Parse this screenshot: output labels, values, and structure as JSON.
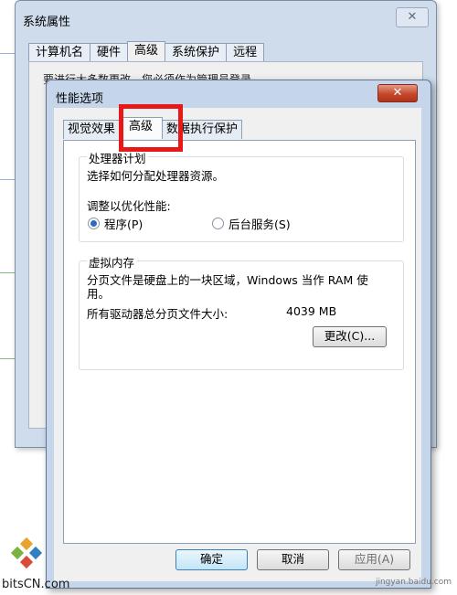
{
  "background_window": {
    "title": "系统属性",
    "close_glyph": "✕",
    "tabs": [
      {
        "label": "计算机名",
        "selected": false
      },
      {
        "label": "硬件",
        "selected": false
      },
      {
        "label": "高级",
        "selected": true
      },
      {
        "label": "系统保护",
        "selected": false
      },
      {
        "label": "远程",
        "selected": false
      }
    ],
    "partial_text": "要进行大多数更改，您必须作为管理员登录。"
  },
  "dialog": {
    "title": "性能选项",
    "close_glyph": "✕",
    "tabs": [
      {
        "label": "视觉效果",
        "selected": false
      },
      {
        "label": "高级",
        "selected": true
      },
      {
        "label": "数据执行保护",
        "selected": false
      }
    ],
    "processor_group": {
      "title": "处理器计划",
      "description": "选择如何分配处理器资源。",
      "adjust_label": "调整以优化性能:",
      "options": [
        {
          "label": "程序(P)",
          "selected": true
        },
        {
          "label": "后台服务(S)",
          "selected": false
        }
      ]
    },
    "virtual_memory_group": {
      "title": "虚拟内存",
      "description_line1": "分页文件是硬盘上的一块区域，Windows 当作 RAM 使",
      "description_line2": "用。",
      "total_label": "所有驱动器总分页文件大小:",
      "total_value": "4039 MB",
      "change_button": "更改(C)..."
    },
    "buttons": {
      "ok": "确定",
      "cancel": "取消",
      "apply": "应用(A)"
    }
  },
  "watermark": {
    "logo_text": "bitsCN.com",
    "url_text": "jingyan.baidu.com"
  },
  "colors": {
    "highlight_box": "#e81818",
    "close_button": "#c4472c",
    "window_frame": "#c6d6ea"
  }
}
